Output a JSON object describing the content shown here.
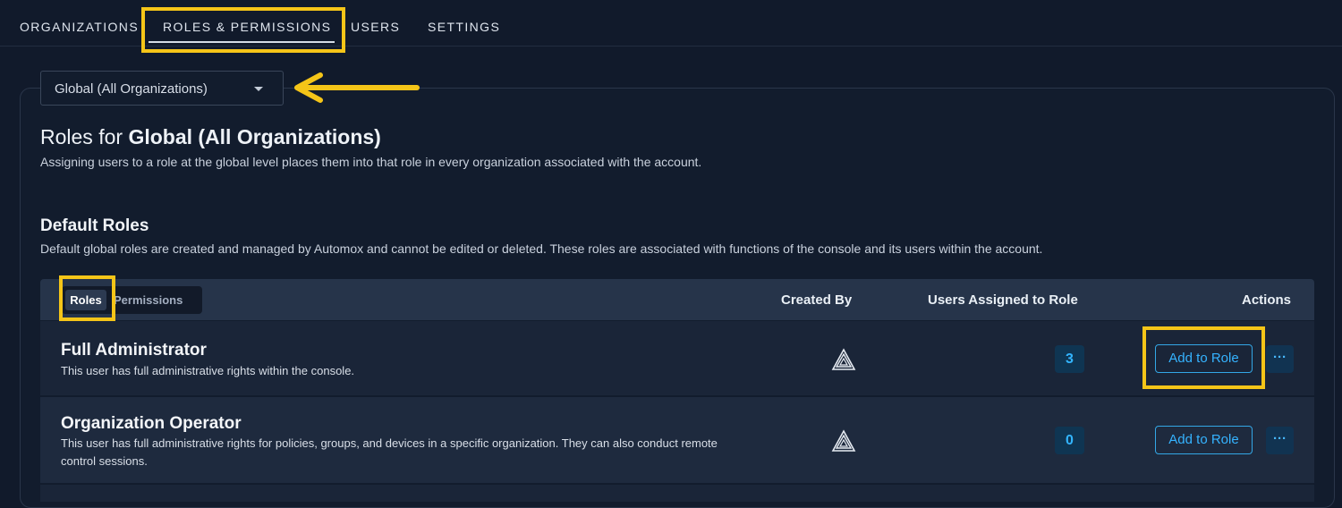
{
  "nav": {
    "tabs": [
      {
        "label": "ORGANIZATIONS"
      },
      {
        "label": "ROLES & PERMISSIONS",
        "active": true
      },
      {
        "label": "USERS"
      },
      {
        "label": "SETTINGS"
      }
    ]
  },
  "org_select": {
    "value": "Global (All Organizations)"
  },
  "page": {
    "heading_prefix": "Roles for",
    "heading_bold": "Global (All Organizations)",
    "subtitle": "Assigning users to a role at the global level places them into that role in every organization associated with the account."
  },
  "default_roles": {
    "title": "Default Roles",
    "description": "Default global roles are created and managed by Automox and cannot be edited or deleted. These roles are associated with functions of the console and its users within the account."
  },
  "table": {
    "toggle": {
      "roles": "Roles",
      "permissions": "Permissions"
    },
    "columns": {
      "created_by": "Created By",
      "users_assigned": "Users Assigned to Role",
      "actions": "Actions"
    },
    "rows": [
      {
        "name": "Full Administrator",
        "description": "This user has full administrative rights within the console.",
        "created_by_icon": "automox-logo-icon",
        "users_assigned": "3",
        "add_label": "Add to Role",
        "more_label": "···"
      },
      {
        "name": "Organization Operator",
        "description": "This user has full administrative rights for policies, groups, and devices in a specific organization. They can also conduct remote control sessions.",
        "created_by_icon": "automox-logo-icon",
        "users_assigned": "0",
        "add_label": "Add to Role",
        "more_label": "···"
      }
    ]
  },
  "colors": {
    "background": "#111a2b",
    "accent": "#35b3ff",
    "highlight": "#f5c518"
  }
}
